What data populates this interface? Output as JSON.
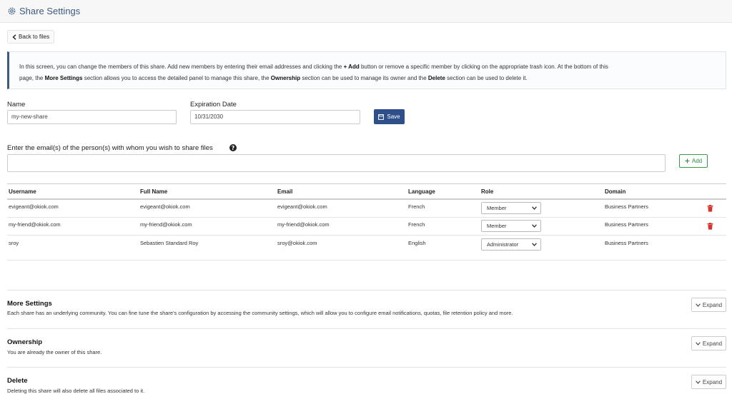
{
  "header": {
    "title": "Share Settings"
  },
  "back_button": {
    "label": "Back to files"
  },
  "info": {
    "p1": "In this screen, you can change the members of this share. Add new members by entering their email addresses and clicking the ",
    "add_word": "+ Add",
    "p2": " button or remove a specific member by clicking on the appropriate trash icon. At the bottom of this",
    "p3": "page, the ",
    "more_settings_word": "More Settings",
    "p4": " section allows you to access the detailed panel to manage this share, the ",
    "ownership_word": "Ownership",
    "p5": " section can be used to manage its owner and the ",
    "delete_word": "Delete",
    "p6": " section can be used to delete it."
  },
  "form": {
    "name_label": "Name",
    "name_value": "my-new-share",
    "expiration_label": "Expiration Date",
    "expiration_value": "10/31/2030",
    "save_label": "Save",
    "email_label": "Enter the email(s) of the person(s) with whom you wish to share files",
    "add_label": "Add"
  },
  "table": {
    "headers": [
      "Username",
      "Full Name",
      "Email",
      "Language",
      "Role",
      "Domain"
    ],
    "rows": [
      {
        "username": "evigeant@okiok.com",
        "full_name": "evigeant@okiok.com",
        "email": "evigeant@okiok.com",
        "language": "French",
        "role": "Member",
        "domain": "Business Partners"
      },
      {
        "username": "my-friend@okiok.com",
        "full_name": "my-friend@okiok.com",
        "email": "my-friend@okiok.com",
        "language": "French",
        "role": "Member",
        "domain": "Business Partners"
      },
      {
        "username": "sroy",
        "full_name": "Sebastien Standard Roy",
        "email": "sroy@okiok.com",
        "language": "English",
        "role": "Administrator",
        "domain": "Business Partners"
      }
    ]
  },
  "sections": {
    "more_settings": {
      "title": "More Settings",
      "desc": "Each share has an underlying community. You can fine tune the share's configuration by accessing the community settings, which will allow you to configure email notifications, quotas, file retention policy and more.",
      "button": "Expand"
    },
    "ownership": {
      "title": "Ownership",
      "desc": "You are already the owner of this share.",
      "button": "Expand"
    },
    "delete": {
      "title": "Delete",
      "desc": "Deleting this share will also delete all files associated to it.",
      "button": "Expand"
    }
  },
  "colors": {
    "accent": "#3d5a80",
    "save_button": "#2f4f8a",
    "add_button": "#2f8a40",
    "trash": "#d9342b"
  }
}
